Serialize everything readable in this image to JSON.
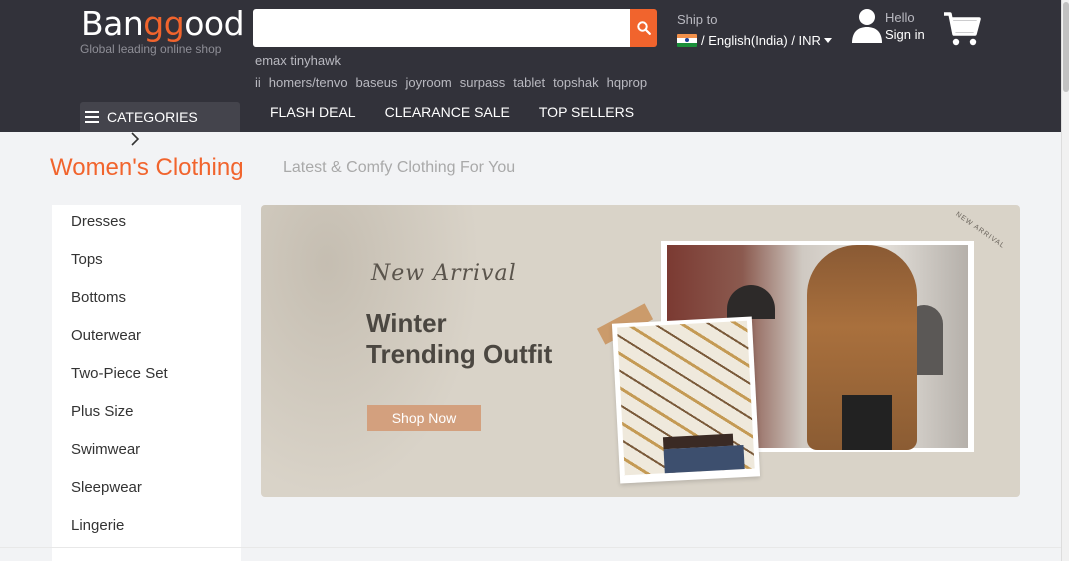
{
  "header": {
    "logo": {
      "part1": "Ban",
      "accent": "gg",
      "part2": "ood",
      "tagline": "Global leading online shop"
    },
    "search": {
      "placeholder": "",
      "value": ""
    },
    "hot_words": [
      "emax tinyhawk ii",
      "homers/tenvo",
      "baseus",
      "joyroom",
      "surpass",
      "tablet",
      "topshak",
      "hqprop"
    ],
    "ship_to": {
      "label": "Ship to",
      "value": "/ English(India) / INR"
    },
    "user": {
      "hello": "Hello",
      "signin": "Sign in"
    },
    "categories_label": "CATEGORIES",
    "nav": [
      "FLASH DEAL",
      "CLEARANCE SALE",
      "TOP SELLERS"
    ]
  },
  "section": {
    "title": "Women's Clothing",
    "subtitle": "Latest & Comfy Clothing For You",
    "categories": [
      "Dresses",
      "Tops",
      "Bottoms",
      "Outerwear",
      "Two-Piece Set",
      "Plus Size",
      "Swimwear",
      "Sleepwear",
      "Lingerie"
    ]
  },
  "banner": {
    "script": "New Arrival",
    "headline_line1": "Winter",
    "headline_line2": "Trending Outfit",
    "button": "Shop Now",
    "stamp": "NEW ARRIVAL"
  },
  "colors": {
    "header_bg": "#32323a",
    "accent": "#f1642d",
    "banner_bg": "#d9d3c8",
    "shop_now": "#d3a07e"
  },
  "icons": {
    "search": "search-icon",
    "user": "user-icon",
    "cart": "cart-icon",
    "menu": "menu-icon",
    "flag": "india-flag-icon"
  }
}
